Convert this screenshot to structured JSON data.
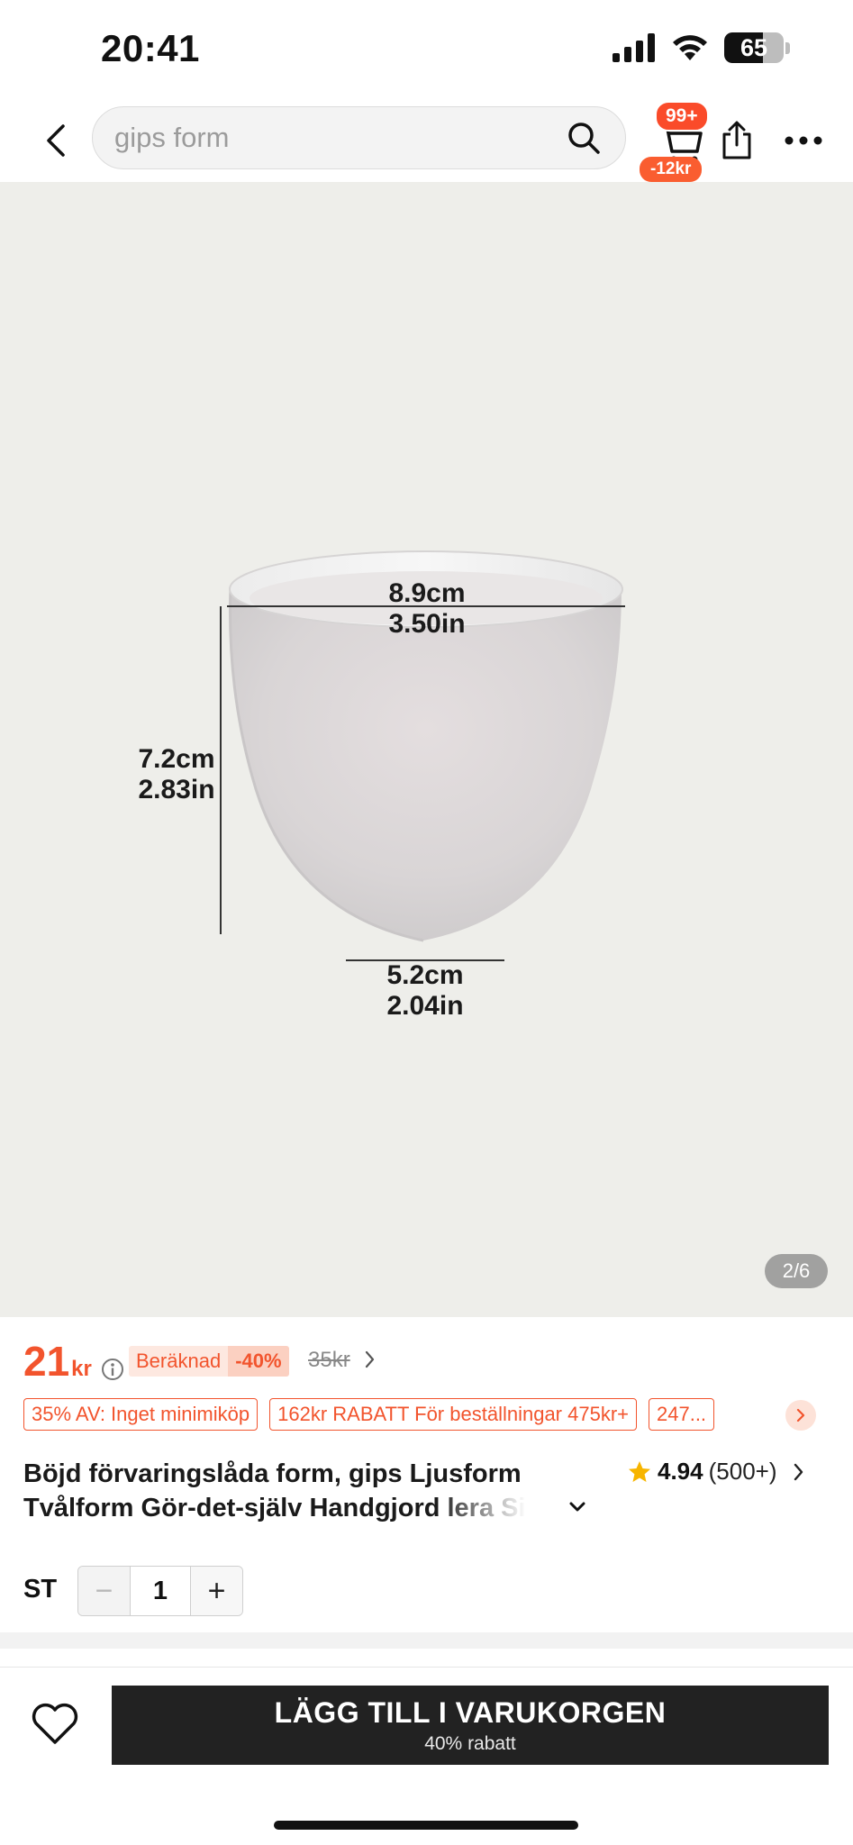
{
  "status_bar": {
    "time": "20:41",
    "battery": "65",
    "icons": [
      "signal-icon",
      "wifi-icon",
      "battery-icon"
    ]
  },
  "header": {
    "search_placeholder": "gips form",
    "cart_count": "99+",
    "cart_discount": "-12kr",
    "icons": [
      "back-icon",
      "search-icon",
      "cart-icon",
      "share-icon",
      "more-icon"
    ]
  },
  "gallery": {
    "counter": "2/6",
    "dimensions": {
      "top_cm": "8.9cm",
      "top_in": "3.50in",
      "height_cm": "7.2cm",
      "height_in": "2.83in",
      "bottom_cm": "5.2cm",
      "bottom_in": "2.04in"
    }
  },
  "price": {
    "amount": "21",
    "currency": "kr",
    "calc_label": "Beräknad",
    "discount_pct": "-40%",
    "old_price": "35kr"
  },
  "promos": [
    "35% AV: Inget minimiköp",
    "162kr RABATT För beställningar 475kr+",
    "247..."
  ],
  "product": {
    "title_line1": "Böjd förvaringslåda form, gips Ljusform",
    "title_line2": "Tvålform Gör-det-själv Handgjord lera Si",
    "rating": "4.94",
    "rating_count": "(500+)"
  },
  "quantity": {
    "label": "ST",
    "value": "1",
    "minus": "−",
    "plus": "+"
  },
  "bottom_bar": {
    "add_to_cart": "LÄGG TILL I VARUKORGEN",
    "add_to_cart_sub": "40% rabatt"
  },
  "colors": {
    "accent": "#f2542d",
    "button_dark": "#222222",
    "badge_red": "#fa4b2a"
  }
}
